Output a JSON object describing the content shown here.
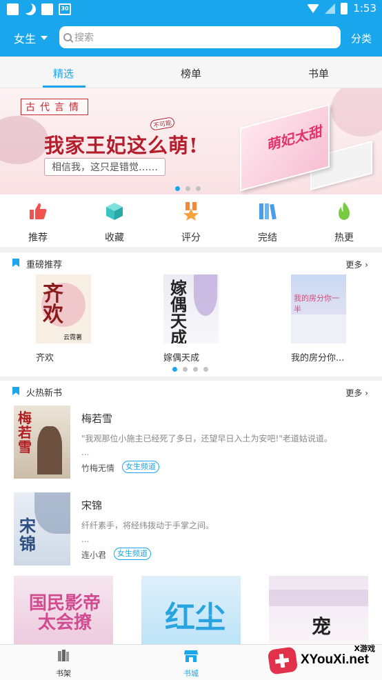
{
  "statusbar": {
    "calendar_day": "30",
    "time": "1:53"
  },
  "header": {
    "gender_label": "女生",
    "search_placeholder": "搜索",
    "classify_label": "分类"
  },
  "tabs": [
    {
      "label": "精选",
      "active": true
    },
    {
      "label": "榜单",
      "active": false
    },
    {
      "label": "书单",
      "active": false
    }
  ],
  "banner": {
    "tag": "古代言情",
    "title": "我家王妃这么萌!",
    "badge": "不可能",
    "subtitle": "相信我，这只是错觉……",
    "book_cover_text": "萌妃太甜",
    "page_count": 3,
    "active_page": 0
  },
  "categories": [
    {
      "label": "推荐",
      "icon": "thumbs-up-icon",
      "color": "#f0524f"
    },
    {
      "label": "收藏",
      "icon": "box-icon",
      "color": "#3cc3c3"
    },
    {
      "label": "评分",
      "icon": "medal-icon",
      "color": "#f5883a"
    },
    {
      "label": "完结",
      "icon": "books-icon",
      "color": "#4a9ee8"
    },
    {
      "label": "热更",
      "icon": "flame-icon",
      "color": "#7ac943"
    }
  ],
  "featured": {
    "title": "重磅推荐",
    "more": "更多",
    "books": [
      {
        "name": "齐欢",
        "cover_title": "齐欢",
        "cover_author": "云霓著"
      },
      {
        "name": "嫁偶天成",
        "cover_title": "嫁偶天成"
      },
      {
        "name": "我的房分你...",
        "cover_title": "我的房分你一半"
      }
    ],
    "page_count": 4,
    "active_page": 0
  },
  "hot": {
    "title": "火热新书",
    "more": "更多",
    "items": [
      {
        "title": "梅若雪",
        "desc": "\"我观那位小施主已经死了多日，还望早日入土为安吧!\"老道姑说道。",
        "ellipsis": "...",
        "author": "竹梅无情",
        "badge": "女生频道",
        "cover_title": "梅若雪"
      },
      {
        "title": "宋锦",
        "desc": "纤纤素手，将经纬拨动于手掌之间。",
        "ellipsis": "...",
        "author": "连小君",
        "badge": "女生频道",
        "cover_title": "宋锦"
      }
    ],
    "grid_covers": [
      {
        "cover_title": "国民影帝太会撩"
      },
      {
        "cover_title": "红尘"
      },
      {
        "cover_title": "宠"
      }
    ]
  },
  "bottom_nav": [
    {
      "label": "书架",
      "icon": "bookshelf-icon",
      "active": false
    },
    {
      "label": "书城",
      "icon": "store-icon",
      "active": true
    }
  ],
  "watermark": {
    "small": "X游戏",
    "big": "XYouXi.net"
  }
}
